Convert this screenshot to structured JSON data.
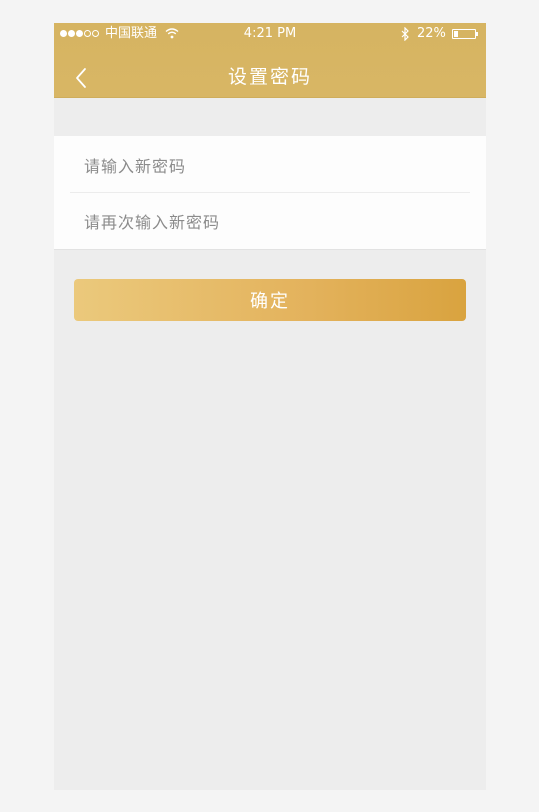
{
  "status_bar": {
    "carrier": "中国联通",
    "time": "4:21 PM",
    "battery_percent": "22%",
    "battery_level": 0.22,
    "signal_bars_filled": 3,
    "signal_bars_total": 5
  },
  "nav": {
    "title": "设置密码",
    "back_icon": "chevron-left-icon"
  },
  "form": {
    "new_password": {
      "placeholder": "请输入新密码",
      "value": ""
    },
    "confirm_password": {
      "placeholder": "请再次输入新密码",
      "value": ""
    }
  },
  "actions": {
    "confirm_label": "确定"
  },
  "colors": {
    "header": "#d6b461",
    "button_start": "#ebc97c",
    "button_end": "#d9a33f",
    "background": "#ededed"
  }
}
